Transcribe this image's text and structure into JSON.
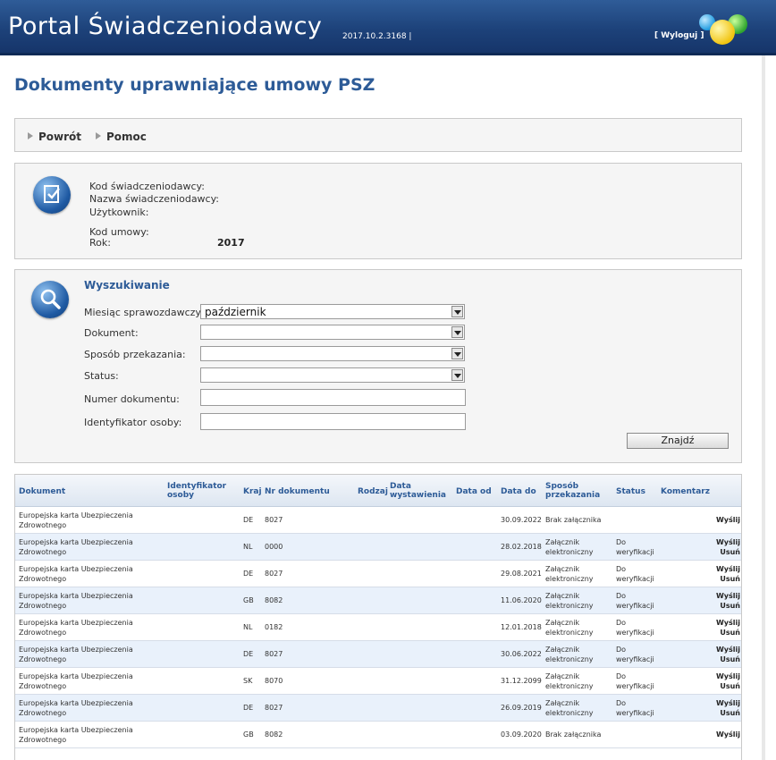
{
  "header": {
    "title": "Portal Świadczeniodawcy",
    "version": "2017.10.2.3168 |",
    "logout": "[ Wyloguj ]"
  },
  "page_title": "Dokumenty uprawniające umowy PSZ",
  "nav": {
    "back": "Powrót",
    "help": "Pomoc"
  },
  "info": {
    "provider_code_label": "Kod świadczeniodawcy:",
    "provider_name_label": "Nazwa świadczeniodawcy:",
    "user_label": "Użytkownik:",
    "contract_code_label": "Kod umowy:",
    "year_label": "Rok:",
    "year_value": "2017"
  },
  "search": {
    "title": "Wyszukiwanie",
    "fields": {
      "month_label": "Miesiąc sprawozdawczy:",
      "month_value": "październik",
      "document_label": "Dokument:",
      "document_value": "",
      "transfer_label": "Sposób przekazania:",
      "transfer_value": "",
      "status_label": "Status:",
      "status_value": "",
      "docnum_label": "Numer dokumentu:",
      "docnum_value": "",
      "personid_label": "Identyfikator osoby:",
      "personid_value": ""
    },
    "find_button": "Znajdź"
  },
  "table": {
    "headers": {
      "dokument": "Dokument",
      "identyfikator": "Identyfikator osoby",
      "kraj": "Kraj",
      "nr": "Nr dokumentu",
      "rodzaj": "Rodzaj",
      "data_wyst": "Data wystawienia",
      "data_od": "Data od",
      "data_do": "Data do",
      "sposob": "Sposób przekazania",
      "status": "Status",
      "komentarz": "Komentarz"
    },
    "rows": [
      {
        "doc": "Europejska karta Ubezpieczenia Zdrowotnego",
        "kraj": "DE",
        "nr": "8027",
        "data_do": "30.09.2022",
        "sposob": "Brak załącznika",
        "status": "",
        "actions": [
          "Wyślij"
        ]
      },
      {
        "doc": "Europejska karta Ubezpieczenia Zdrowotnego",
        "kraj": "NL",
        "nr": "0000",
        "data_do": "28.02.2018",
        "sposob": "Załącznik elektroniczny",
        "status": "Do weryfikacji",
        "actions": [
          "Wyślij",
          "Usuń"
        ]
      },
      {
        "doc": "Europejska karta Ubezpieczenia Zdrowotnego",
        "kraj": "DE",
        "nr": "8027",
        "data_do": "29.08.2021",
        "sposob": "Załącznik elektroniczny",
        "status": "Do weryfikacji",
        "actions": [
          "Wyślij",
          "Usuń"
        ]
      },
      {
        "doc": "Europejska karta Ubezpieczenia Zdrowotnego",
        "kraj": "GB",
        "nr": "8082",
        "data_do": "11.06.2020",
        "sposob": "Załącznik elektroniczny",
        "status": "Do weryfikacji",
        "actions": [
          "Wyślij",
          "Usuń"
        ]
      },
      {
        "doc": "Europejska karta Ubezpieczenia Zdrowotnego",
        "kraj": "NL",
        "nr": "0182",
        "data_do": "12.01.2018",
        "sposob": "Załącznik elektroniczny",
        "status": "Do weryfikacji",
        "actions": [
          "Wyślij",
          "Usuń"
        ]
      },
      {
        "doc": "Europejska karta Ubezpieczenia Zdrowotnego",
        "kraj": "DE",
        "nr": "8027",
        "data_do": "30.06.2022",
        "sposob": "Załącznik elektroniczny",
        "status": "Do weryfikacji",
        "actions": [
          "Wyślij",
          "Usuń"
        ]
      },
      {
        "doc": "Europejska karta Ubezpieczenia Zdrowotnego",
        "kraj": "SK",
        "nr": "8070",
        "data_do": "31.12.2099",
        "sposob": "Załącznik elektroniczny",
        "status": "Do weryfikacji",
        "actions": [
          "Wyślij",
          "Usuń"
        ]
      },
      {
        "doc": "Europejska karta Ubezpieczenia Zdrowotnego",
        "kraj": "DE",
        "nr": "8027",
        "data_do": "26.09.2019",
        "sposob": "Załącznik elektroniczny",
        "status": "Do weryfikacji",
        "actions": [
          "Wyślij",
          "Usuń"
        ]
      },
      {
        "doc": "Europejska karta Ubezpieczenia Zdrowotnego",
        "kraj": "GB",
        "nr": "8082",
        "data_do": "03.09.2020",
        "sposob": "Brak załącznika",
        "status": "",
        "actions": [
          "Wyślij"
        ]
      }
    ]
  }
}
